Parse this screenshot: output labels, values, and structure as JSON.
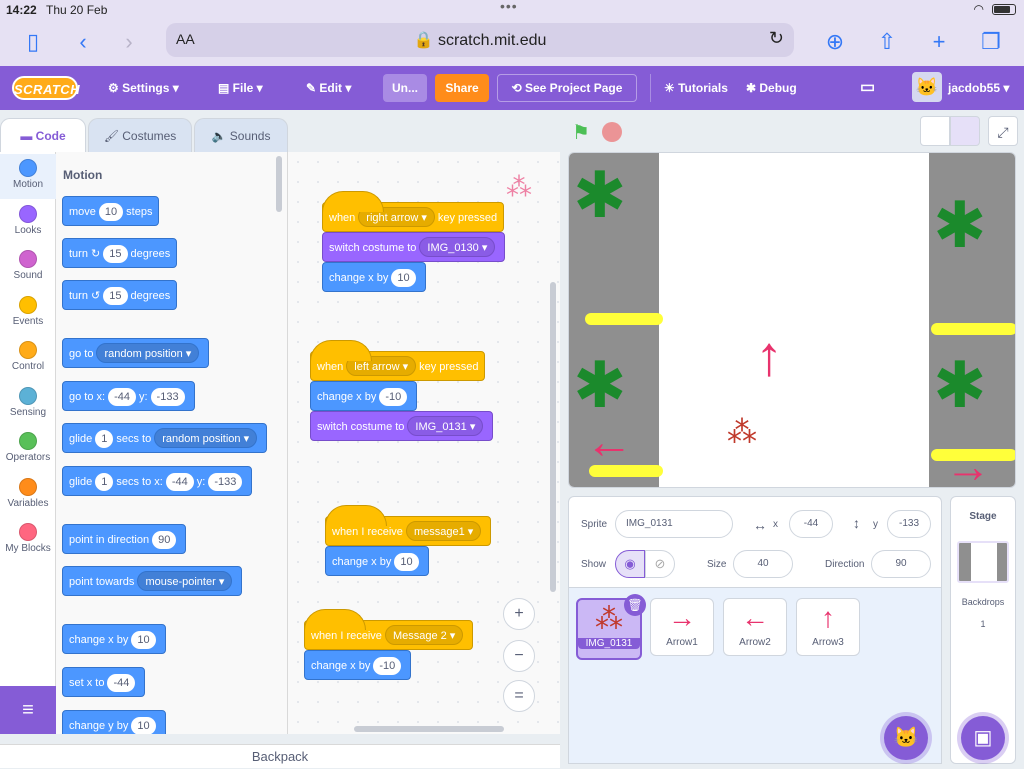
{
  "status": {
    "time": "14:22",
    "date": "Thu 20 Feb"
  },
  "browser": {
    "text_size": "AA",
    "url": "scratch.mit.edu"
  },
  "menu": {
    "logo": "SCRATCH",
    "settings": "Settings",
    "file": "File",
    "edit": "Edit",
    "project_title": "Un...",
    "share": "Share",
    "see_project_page": "See Project Page",
    "tutorials": "Tutorials",
    "debug": "Debug",
    "username": "jacdob55"
  },
  "tabs": {
    "code": "Code",
    "costumes": "Costumes",
    "sounds": "Sounds"
  },
  "categories": [
    {
      "label": "Motion",
      "color": "#4c97ff"
    },
    {
      "label": "Looks",
      "color": "#9966ff"
    },
    {
      "label": "Sound",
      "color": "#cf63cf"
    },
    {
      "label": "Events",
      "color": "#ffbf00"
    },
    {
      "label": "Control",
      "color": "#ffab19"
    },
    {
      "label": "Sensing",
      "color": "#5cb1d6"
    },
    {
      "label": "Operators",
      "color": "#59c059"
    },
    {
      "label": "Variables",
      "color": "#ff8c1a"
    },
    {
      "label": "My Blocks",
      "color": "#ff6680"
    }
  ],
  "palette": {
    "title": "Motion",
    "move": {
      "a": "move",
      "v": "10",
      "b": "steps"
    },
    "turn_cw": {
      "a": "turn",
      "v": "15",
      "b": "degrees"
    },
    "turn_ccw": {
      "a": "turn",
      "v": "15",
      "b": "degrees"
    },
    "goto": {
      "a": "go to",
      "dd": "random position"
    },
    "goto_xy": {
      "a": "go to x:",
      "x": "-44",
      "b": "y:",
      "y": "-133"
    },
    "glide": {
      "a": "glide",
      "v": "1",
      "b": "secs to",
      "dd": "random position"
    },
    "glide_xy": {
      "a": "glide",
      "v": "1",
      "b": "secs to x:",
      "x": "-44",
      "c": "y:",
      "y": "-133"
    },
    "point_dir": {
      "a": "point in direction",
      "v": "90"
    },
    "point_towards": {
      "a": "point towards",
      "dd": "mouse-pointer"
    },
    "change_x": {
      "a": "change x by",
      "v": "10"
    },
    "set_x": {
      "a": "set x to",
      "v": "-44"
    },
    "change_y": {
      "a": "change y by",
      "v": "10"
    }
  },
  "scripts": {
    "s1": {
      "when": "when",
      "key": "right arrow",
      "pressed": "key pressed",
      "switch": "switch costume to",
      "costume": "IMG_0130",
      "change": "change x by",
      "val": "10"
    },
    "s2": {
      "when": "when",
      "key": "left arrow",
      "pressed": "key pressed",
      "change": "change x by",
      "val": "-10",
      "switch": "switch costume to",
      "costume": "IMG_0131"
    },
    "s3": {
      "when": "when I receive",
      "msg": "message1",
      "change": "change x by",
      "val": "10"
    },
    "s4": {
      "when": "when I receive",
      "msg": "Message 2",
      "change": "change x by",
      "val": "-10"
    }
  },
  "zoom": {
    "in": "+",
    "out": "−",
    "reset": "="
  },
  "backpack": "Backpack",
  "sprite_info": {
    "sprite_label": "Sprite",
    "sprite_name": "IMG_0131",
    "x_label": "x",
    "x": "-44",
    "y_label": "y",
    "y": "-133",
    "show_label": "Show",
    "size_label": "Size",
    "size": "40",
    "direction_label": "Direction",
    "direction": "90"
  },
  "sprites": [
    {
      "name": "IMG_0131",
      "glyph": "",
      "selected": true
    },
    {
      "name": "Arrow1",
      "glyph": "→"
    },
    {
      "name": "Arrow2",
      "glyph": "←"
    },
    {
      "name": "Arrow3",
      "glyph": "↑"
    }
  ],
  "stage_panel": {
    "title": "Stage",
    "backdrops_label": "Backdrops",
    "backdrops_count": "1"
  },
  "colors": {
    "accent": "#855cd6",
    "motion": "#4c97ff",
    "events": "#ffbf00",
    "looks": "#9966ff",
    "arrow_pink": "#e8336d"
  }
}
